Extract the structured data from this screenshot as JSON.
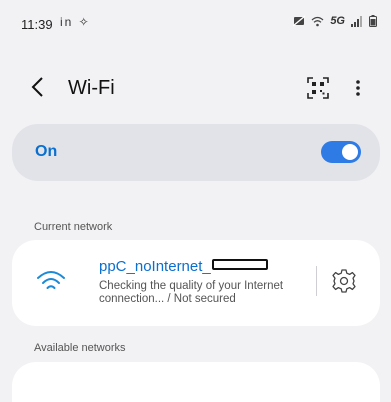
{
  "status_bar": {
    "time": "11:39",
    "left_icons": "in ✧",
    "network_type": "5G"
  },
  "header": {
    "title": "Wi-Fi",
    "back_icon": "chevron-left-icon",
    "qr_icon": "qr-scan-icon",
    "more_icon": "more-vertical-icon"
  },
  "wifi_toggle": {
    "label": "On",
    "state": "on",
    "color": "#2f7be6"
  },
  "current_network": {
    "section_label": "Current network",
    "name": "ppC_noInternet_",
    "status": "Checking the quality of your Internet connection... / Not secured",
    "icon": "wifi-icon",
    "settings_icon": "gear-icon"
  },
  "available_networks": {
    "section_label": "Available networks"
  },
  "colors": {
    "accent": "#0a6fcf",
    "background": "#f2f2f4",
    "card": "#ffffff",
    "toggle_card": "#e2e3e8"
  }
}
